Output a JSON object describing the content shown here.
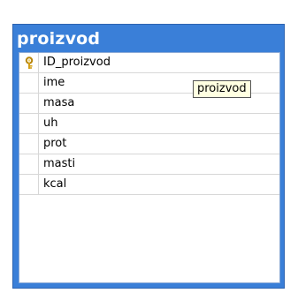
{
  "table": {
    "title": "proizvod",
    "columns": [
      {
        "name": "ID_proizvod",
        "primary_key": true,
        "icon": "key-icon"
      },
      {
        "name": "ime",
        "primary_key": false
      },
      {
        "name": "masa",
        "primary_key": false
      },
      {
        "name": "uh",
        "primary_key": false
      },
      {
        "name": "prot",
        "primary_key": false
      },
      {
        "name": "masti",
        "primary_key": false
      },
      {
        "name": "kcal",
        "primary_key": false
      }
    ]
  },
  "tooltip": {
    "text": "proizvod"
  },
  "colors": {
    "title_bar": "#3a7fd8",
    "key_icon": "#d4a017",
    "tooltip_bg": "#ffffe1"
  }
}
